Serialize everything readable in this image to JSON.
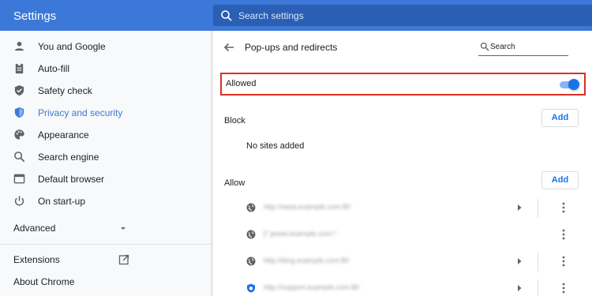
{
  "app": {
    "title": "Settings"
  },
  "search": {
    "placeholder": "Search settings",
    "icon": "search-icon"
  },
  "sidebar": {
    "items": [
      {
        "label": "You and Google",
        "icon": "person-icon"
      },
      {
        "label": "Auto-fill",
        "icon": "clipboard-icon"
      },
      {
        "label": "Safety check",
        "icon": "shield-check-icon"
      },
      {
        "label": "Privacy and security",
        "icon": "shield-lock-icon",
        "active": true
      },
      {
        "label": "Appearance",
        "icon": "palette-icon"
      },
      {
        "label": "Search engine",
        "icon": "search-icon"
      },
      {
        "label": "Default browser",
        "icon": "browser-icon"
      },
      {
        "label": "On start-up",
        "icon": "power-icon"
      }
    ],
    "advanced": {
      "label": "Advanced",
      "icon": "chevron-down-icon"
    },
    "extensions": {
      "label": "Extensions",
      "icon": "external-link-icon"
    },
    "about": {
      "label": "About Chrome"
    }
  },
  "page": {
    "title": "Pop-ups and redirects",
    "back_icon": "back-arrow-icon",
    "search_placeholder": "Search",
    "allowed_label": "Allowed",
    "allowed_enabled": true,
    "block": {
      "label": "Block",
      "add_label": "Add",
      "empty": "No sites added"
    },
    "allow": {
      "label": "Allow",
      "add_label": "Add",
      "sites": [
        {
          "url": "http://www.example.com:80",
          "has_arrow": true
        },
        {
          "url": "[*.]www.example.com:*",
          "has_arrow": false
        },
        {
          "url": "http://blog.example.com:80",
          "has_arrow": true
        },
        {
          "url": "http://support.example.com:80",
          "has_arrow": true,
          "icon_color": "#1a73e8"
        }
      ]
    }
  },
  "colors": {
    "accent": "#3c78d8",
    "highlight_border": "#d93025",
    "toggle_on": "#1a73e8"
  }
}
